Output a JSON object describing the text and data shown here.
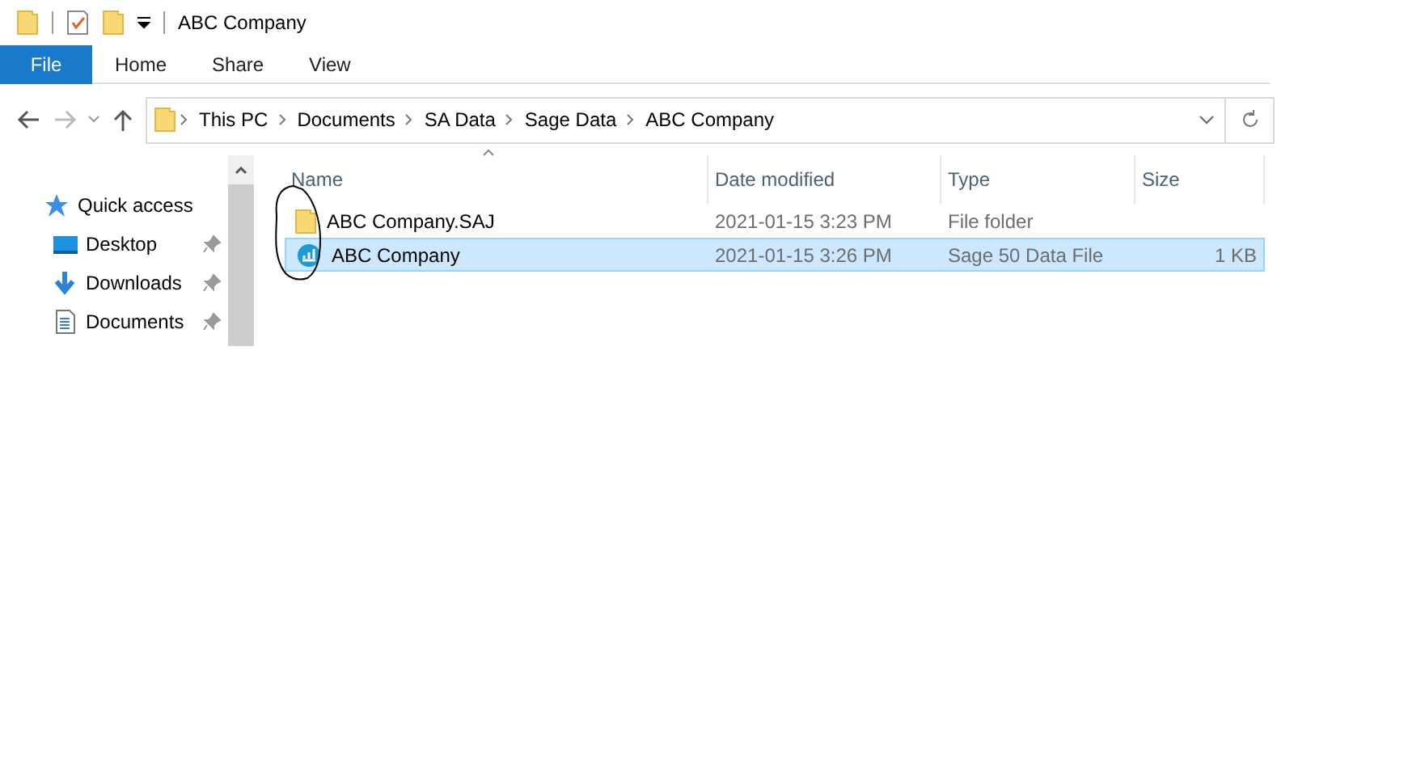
{
  "window": {
    "title": "ABC Company"
  },
  "ribbon_tabs": [
    {
      "label": "File",
      "selected": true
    },
    {
      "label": "Home",
      "selected": false
    },
    {
      "label": "Share",
      "selected": false
    },
    {
      "label": "View",
      "selected": false
    }
  ],
  "breadcrumb": [
    "This PC",
    "Documents",
    "SA Data",
    "Sage Data",
    "ABC Company"
  ],
  "sidebar": {
    "items": [
      {
        "label": "Quick access",
        "kind": "header",
        "pinned": false
      },
      {
        "label": "Desktop",
        "kind": "desktop",
        "pinned": true
      },
      {
        "label": "Downloads",
        "kind": "downloads",
        "pinned": true
      },
      {
        "label": "Documents",
        "kind": "documents",
        "pinned": true
      }
    ]
  },
  "table": {
    "columns": [
      {
        "label": "Name",
        "sorted": true
      },
      {
        "label": "Date modified",
        "sorted": false
      },
      {
        "label": "Type",
        "sorted": false
      },
      {
        "label": "Size",
        "sorted": false
      }
    ],
    "rows": [
      {
        "kind": "folder",
        "name": "ABC Company.SAJ",
        "date": "2021-01-15 3:23 PM",
        "type": "File folder",
        "selected": false
      },
      {
        "kind": "data-file",
        "name": "ABC Company",
        "date": "2021-01-15 3:26 PM",
        "type": "Sage 50 Data File",
        "size": "1 KB",
        "selected": true
      }
    ]
  }
}
